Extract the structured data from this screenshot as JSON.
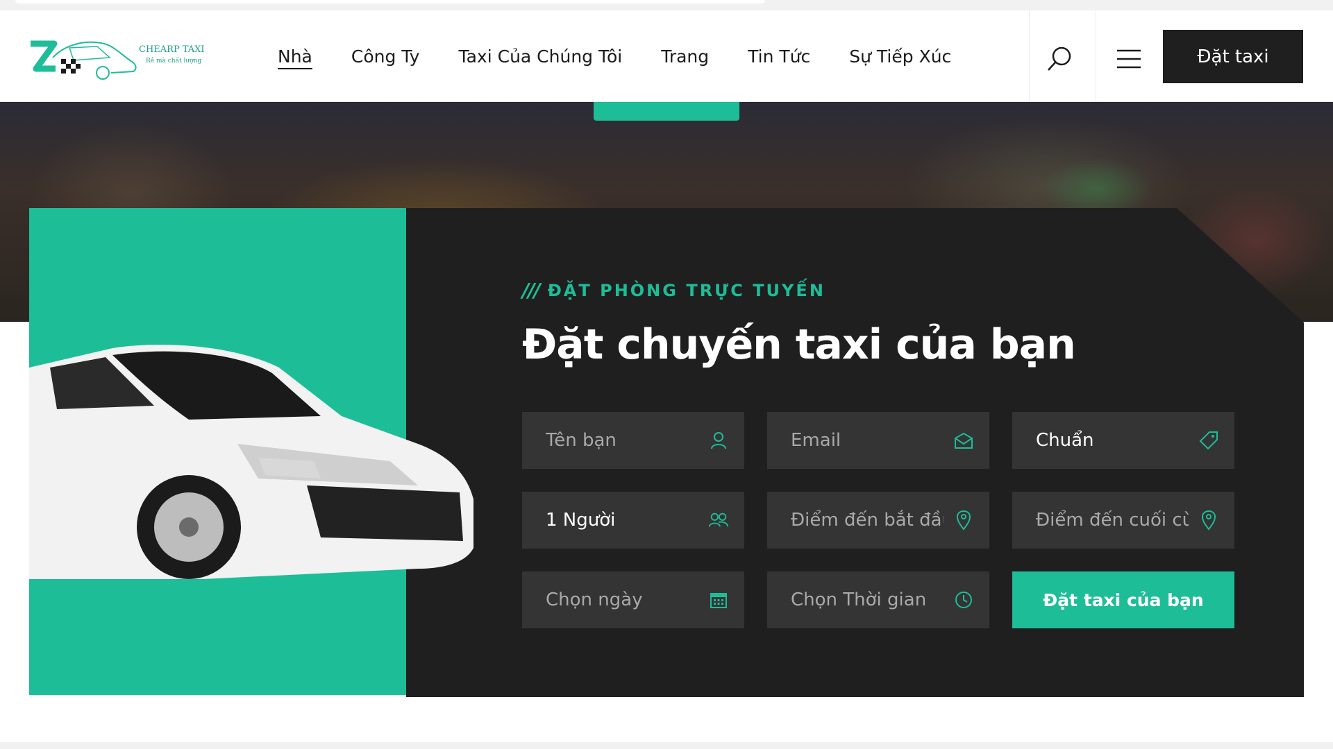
{
  "header": {
    "logo": {
      "brand": "CHEARP TAXI",
      "tagline": "Rẻ mà chất lượng"
    },
    "nav": [
      {
        "label": "Nhà",
        "active": true
      },
      {
        "label": "Công Ty"
      },
      {
        "label": "Taxi Của Chúng Tôi"
      },
      {
        "label": "Trang"
      },
      {
        "label": "Tin Tức"
      },
      {
        "label": "Sự Tiếp Xúc"
      }
    ],
    "search_icon": "search-icon",
    "menu_icon": "hamburger-menu-icon",
    "book_button": "Đặt taxi"
  },
  "booking": {
    "eyebrow_slashes": "///",
    "eyebrow": "ĐẶT PHÒNG TRỰC TUYẾN",
    "title": "Đặt chuyến taxi của bạn",
    "fields": {
      "name": {
        "placeholder": "Tên bạn",
        "icon": "user-icon"
      },
      "email": {
        "placeholder": "Email",
        "icon": "envelope-icon"
      },
      "car_type": {
        "value": "Chuẩn",
        "icon": "tag-icon"
      },
      "passengers": {
        "value": "1 Người",
        "icon": "users-icon"
      },
      "start": {
        "placeholder": "Điểm đến bắt đầu",
        "icon": "map-pin-icon"
      },
      "end": {
        "placeholder": "Điểm đến cuối cùng",
        "icon": "map-pin-icon"
      },
      "date": {
        "placeholder": "Chọn ngày",
        "icon": "calendar-icon"
      },
      "time": {
        "placeholder": "Chọn Thời gian",
        "icon": "clock-icon"
      }
    },
    "submit": "Đặt taxi của bạn"
  },
  "colors": {
    "accent": "#1dbd98",
    "dark_panel": "#1f1f1f",
    "field_bg": "#343434",
    "header_button": "#1f1f1f"
  }
}
